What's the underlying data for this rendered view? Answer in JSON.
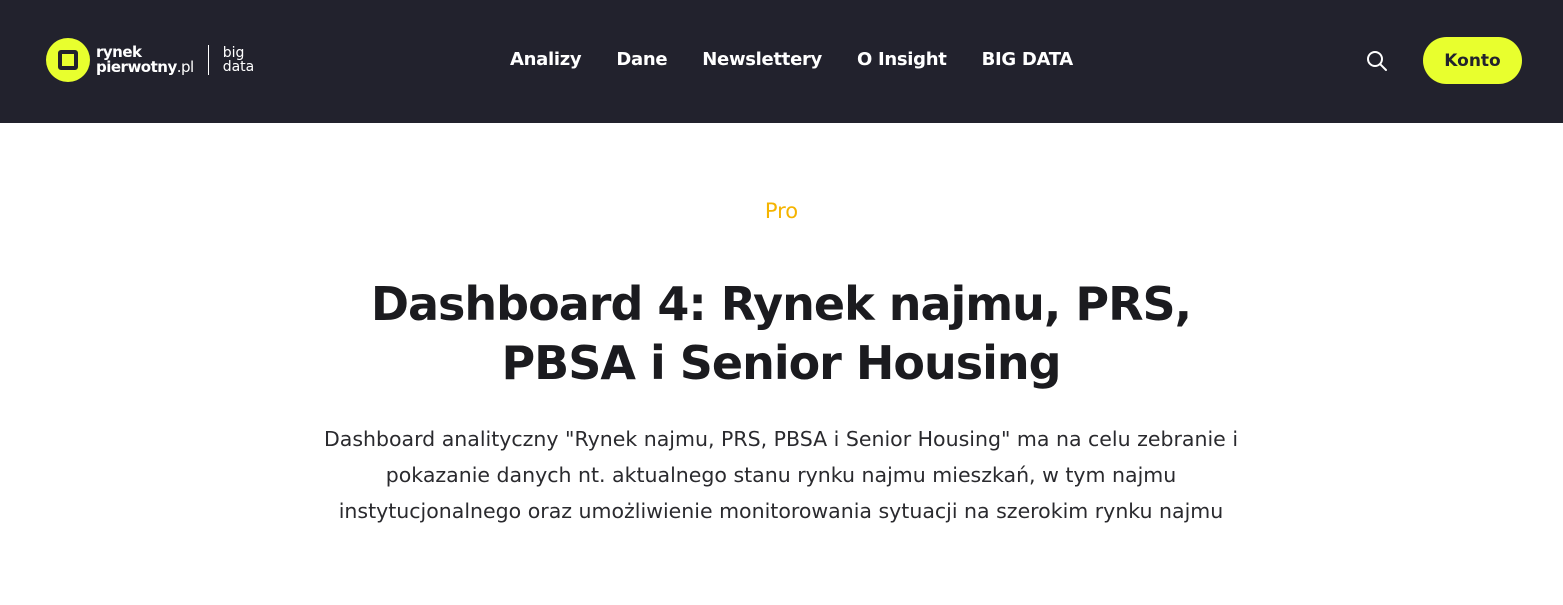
{
  "header": {
    "logo": {
      "line1": "rynek",
      "line2_main": "pierwotny",
      "line2_suffix": ".pl",
      "big_line1": "big",
      "big_line2": "data"
    },
    "nav": [
      {
        "label": "Analizy"
      },
      {
        "label": "Dane"
      },
      {
        "label": "Newslettery"
      },
      {
        "label": "O Insight"
      },
      {
        "label": "BIG DATA"
      }
    ],
    "account_button": "Konto"
  },
  "article": {
    "category": "Pro",
    "title_line1": "Dashboard 4: Rynek najmu, PRS,",
    "title_line2": "PBSA i Senior Housing",
    "description": "Dashboard analityczny \"Rynek najmu, PRS, PBSA i Senior Housing\" ma na celu zebranie i pokazanie danych nt. aktualnego stanu rynku najmu mieszkań, w tym najmu instytucjonalnego oraz umożliwienie monitorowania sytuacji na szerokim rynku najmu"
  },
  "colors": {
    "header_bg": "#22222d",
    "accent": "#e8ff2e",
    "category": "#f5b400"
  },
  "icons": {
    "search": "search-icon",
    "logo": "logo-mark-icon"
  }
}
